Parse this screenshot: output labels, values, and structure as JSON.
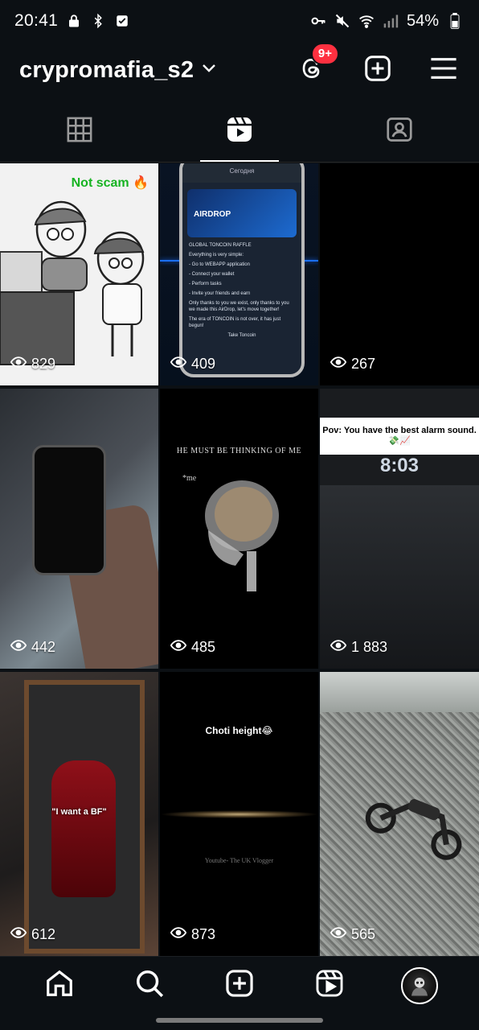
{
  "status_bar": {
    "time": "20:41",
    "battery": "54%",
    "icons_left": [
      "lock-icon",
      "bluetooth-icon",
      "check-square-icon"
    ],
    "icons_right": [
      "key-icon",
      "mute-icon",
      "wifi-icon",
      "signal-icon",
      "battery-icon"
    ]
  },
  "header": {
    "username": "crypromafia_s2",
    "threads_badge": "9+"
  },
  "tabs": [
    {
      "name": "grid",
      "icon": "grid-icon",
      "active": false
    },
    {
      "name": "reels",
      "icon": "reels-icon",
      "active": true
    },
    {
      "name": "tagged",
      "icon": "tagged-icon",
      "active": false
    }
  ],
  "reels": [
    {
      "views": "829",
      "caption": "Not scam 🔥"
    },
    {
      "views": "409",
      "phone_header": "Сегодня",
      "banner": "AIRDROP",
      "lines": [
        "GLOBAL TONCOIN RAFFLE",
        "Everything is very simple:",
        "- Go to WEBAPP application",
        "- Connect your wallet",
        "- Perform tasks",
        "- Invite your friends and earn",
        "Only thanks to you we exist, only thanks to you we made this AirDrop, let's move together!",
        "The era of TONCOIN is not over, it has just begun!",
        "Take Toncoin"
      ]
    },
    {
      "views": "267"
    },
    {
      "views": "442"
    },
    {
      "views": "485",
      "caption": "HE MUST BE THINKING OF ME",
      "subcaption": "*me"
    },
    {
      "views": "1 883",
      "caption": "Pov: You have the best alarm sound.💸📈",
      "clock": "8:03"
    },
    {
      "views": "612",
      "caption": "\"I want a BF\""
    },
    {
      "views": "873",
      "caption": "Choti height😂",
      "credit": "Youtube- The UK Vlogger"
    },
    {
      "views": "565"
    }
  ],
  "bottom_nav": [
    "home-icon",
    "search-icon",
    "create-icon",
    "reels-icon",
    "profile-avatar"
  ]
}
